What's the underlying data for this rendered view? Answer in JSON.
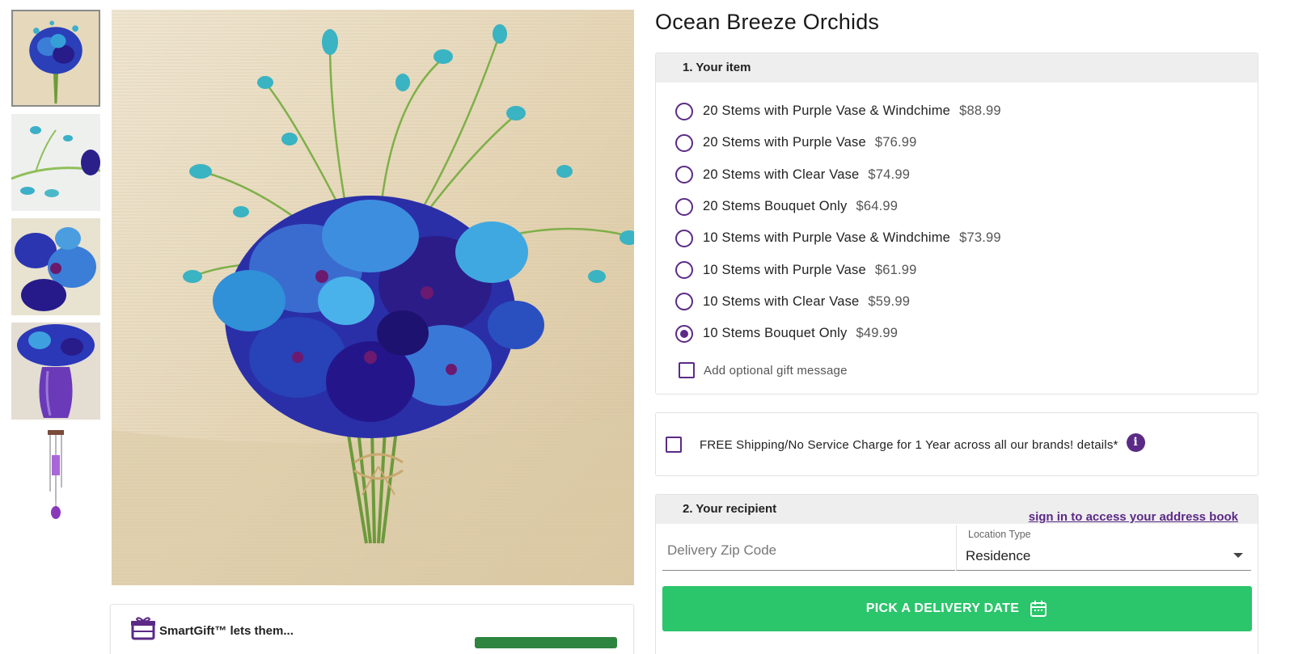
{
  "product": {
    "title": "Ocean Breeze Orchids"
  },
  "thumbnails": [
    {
      "name": "bouquet-front"
    },
    {
      "name": "stem-closeup"
    },
    {
      "name": "bloom-closeup"
    },
    {
      "name": "purple-vase"
    },
    {
      "name": "windchime"
    }
  ],
  "item_section": {
    "heading": "1. Your item",
    "options": [
      {
        "label": "20 Stems with Purple Vase & Windchime",
        "price": "$88.99",
        "selected": false
      },
      {
        "label": "20 Stems with Purple Vase",
        "price": "$76.99",
        "selected": false
      },
      {
        "label": "20 Stems with Clear Vase",
        "price": "$74.99",
        "selected": false
      },
      {
        "label": "20 Stems Bouquet Only",
        "price": "$64.99",
        "selected": false
      },
      {
        "label": "10 Stems with Purple Vase & Windchime",
        "price": "$73.99",
        "selected": false
      },
      {
        "label": "10 Stems with Purple Vase",
        "price": "$61.99",
        "selected": false
      },
      {
        "label": "10 Stems with Clear Vase",
        "price": "$59.99",
        "selected": false
      },
      {
        "label": "10 Stems Bouquet Only",
        "price": "$49.99",
        "selected": true
      }
    ],
    "gift_message_label": "Add optional gift message"
  },
  "shipping_offer": {
    "text": "FREE Shipping/No Service Charge for 1 Year across all our brands! details*",
    "info_icon": "info-icon"
  },
  "recipient_section": {
    "heading": "2. Your recipient",
    "signin_link": "sign in to access your address book",
    "zip_placeholder": "Delivery Zip Code",
    "location_label": "Location Type",
    "location_value": "Residence",
    "pick_button": "PICK A DELIVERY DATE"
  },
  "smartgift": {
    "text": "SmartGift™ lets them..."
  },
  "colors": {
    "brand_purple": "#5b2a86",
    "cta_green": "#2bc56b",
    "smartgift_green": "#2e8540",
    "panel_header": "#eeeeee"
  }
}
